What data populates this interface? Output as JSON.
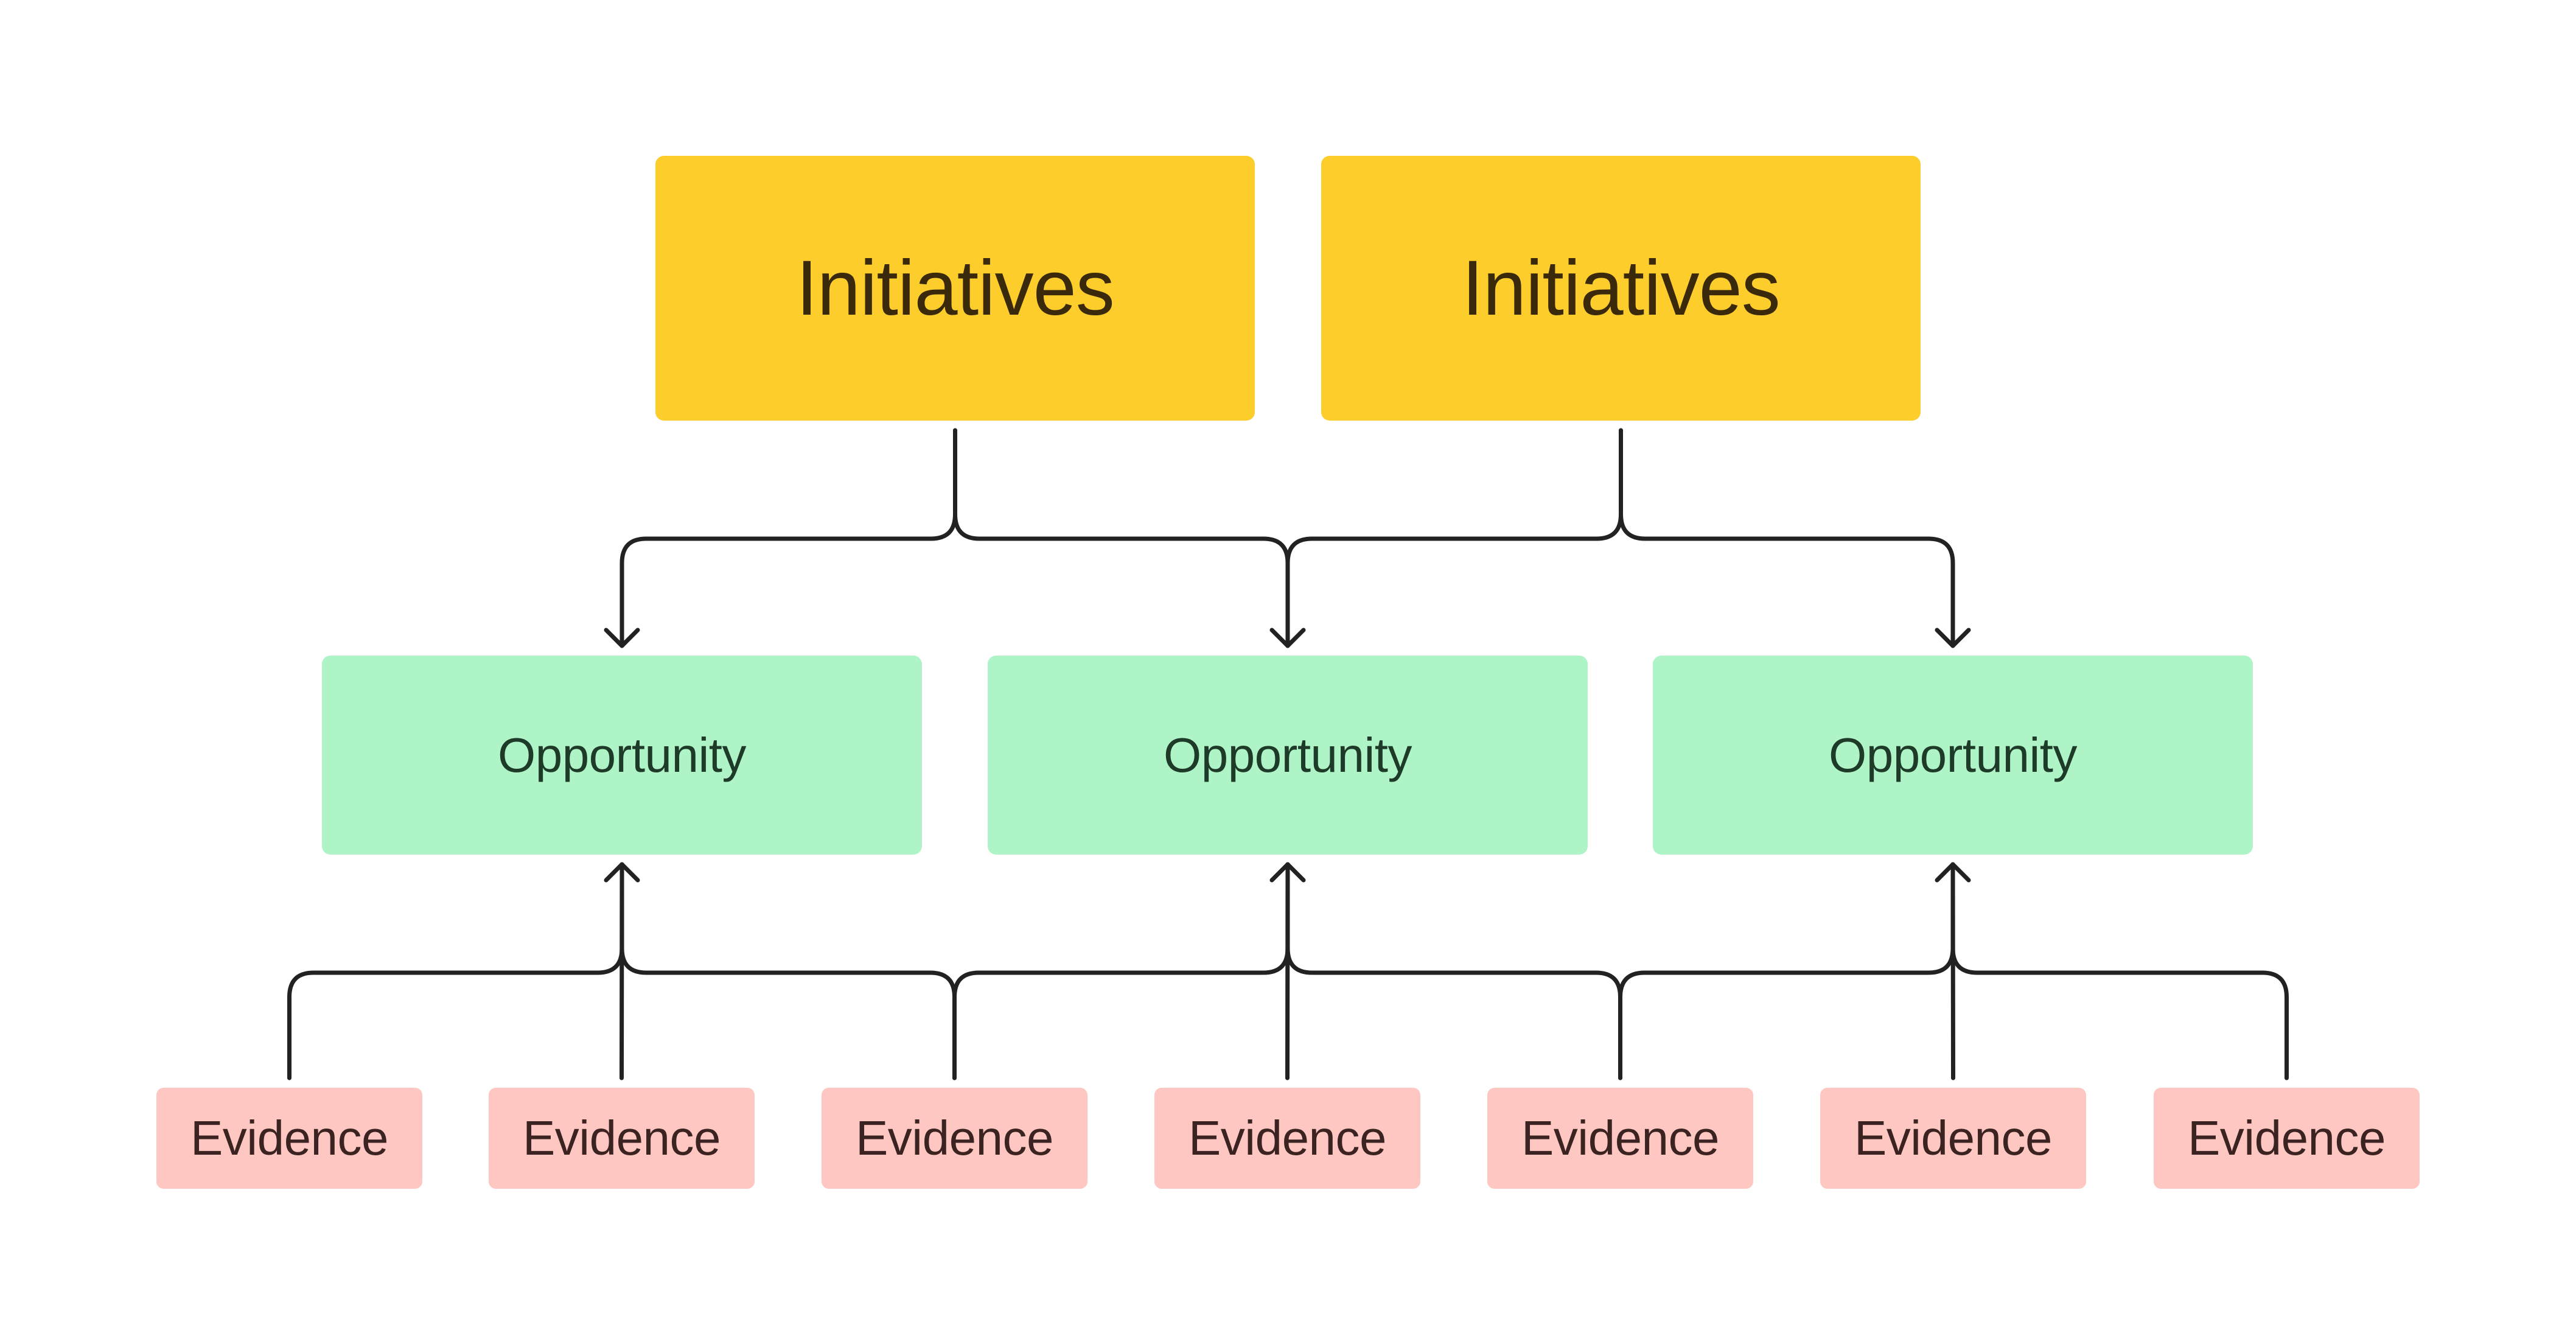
{
  "colors": {
    "initiative_fill": "#FDCD2B",
    "initiative_text": "#3A2A0B",
    "opportunity_fill": "#AFF4C6",
    "opportunity_text": "#1E3A28",
    "evidence_fill": "#FFC7C2",
    "evidence_text": "#3A2320",
    "connector": "#222222"
  },
  "initiatives": [
    {
      "label": "Initiatives"
    },
    {
      "label": "Initiatives"
    }
  ],
  "opportunities": [
    {
      "label": "Opportunity"
    },
    {
      "label": "Opportunity"
    },
    {
      "label": "Opportunity"
    }
  ],
  "evidence": [
    {
      "label": "Evidence",
      "supports": 0
    },
    {
      "label": "Evidence",
      "supports": 0
    },
    {
      "label": "Evidence",
      "supports": 1
    },
    {
      "label": "Evidence",
      "supports": 1
    },
    {
      "label": "Evidence",
      "supports": 2
    },
    {
      "label": "Evidence",
      "supports": 2
    },
    {
      "label": "Evidence",
      "supports": 2
    }
  ],
  "initiative_links": [
    {
      "from": 0,
      "to": [
        0,
        1
      ]
    },
    {
      "from": 1,
      "to": [
        1,
        2
      ]
    }
  ],
  "evidence_links": [
    {
      "to": 0,
      "from": [
        0,
        1,
        2
      ]
    },
    {
      "to": 1,
      "from": [
        2,
        3,
        4
      ]
    },
    {
      "to": 2,
      "from": [
        4,
        5,
        6
      ]
    }
  ]
}
